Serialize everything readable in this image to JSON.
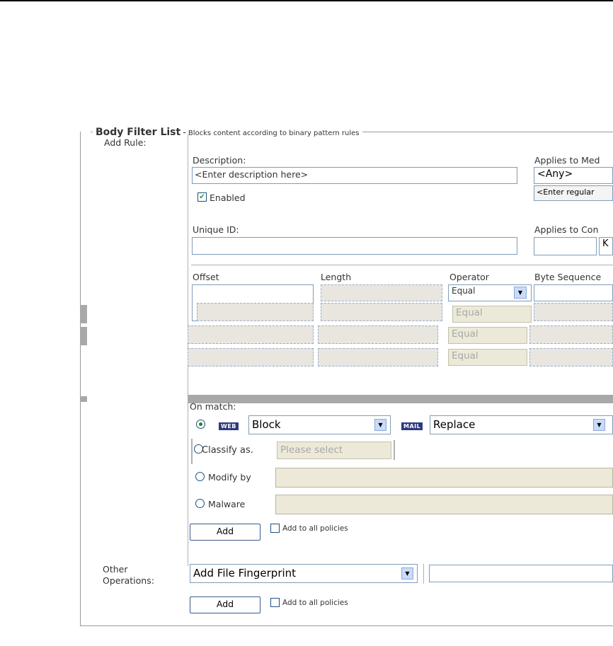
{
  "legend": {
    "title": "Body Filter List",
    "separator": "-",
    "subtitle": "Blocks content according to binary pattern rules"
  },
  "add_rule": {
    "label": "Add Rule:",
    "description_label": "Description:",
    "description_placeholder": "<Enter description here>",
    "enabled_label": "Enabled",
    "enabled_checked": true,
    "applies_media_label": "Applies to Med",
    "applies_media_value": "<Any>",
    "regex_placeholder": "<Enter regular",
    "unique_id_label": "Unique ID:",
    "unique_id_value": "",
    "applies_content_label": "Applies to Con",
    "applies_content_unit": "K"
  },
  "pattern_table": {
    "headers": {
      "offset": "Offset",
      "length": "Length",
      "operator": "Operator",
      "byte_sequence": "Byte Sequence"
    },
    "rows": [
      {
        "operator": "Equal"
      },
      {
        "operator": "Equal"
      },
      {
        "operator": "Equal"
      },
      {
        "operator": "Equal"
      }
    ]
  },
  "on_match": {
    "label": "On match:",
    "web_badge": "WEB",
    "web_action": "Block",
    "mail_badge": "MAIL",
    "mail_action": "Replace",
    "classify_label": "Classify as.",
    "classify_placeholder": "Please select",
    "modify_label": "Modify by",
    "malware_label": "Malware"
  },
  "add_section": {
    "add_button": "Add",
    "all_policies_label": "Add to all policies"
  },
  "other_operations": {
    "label_line1": "Other",
    "label_line2": "Operations:",
    "select_value": "Add File Fingerprint",
    "add_button": "Add",
    "all_policies_label": "Add to all policies"
  }
}
